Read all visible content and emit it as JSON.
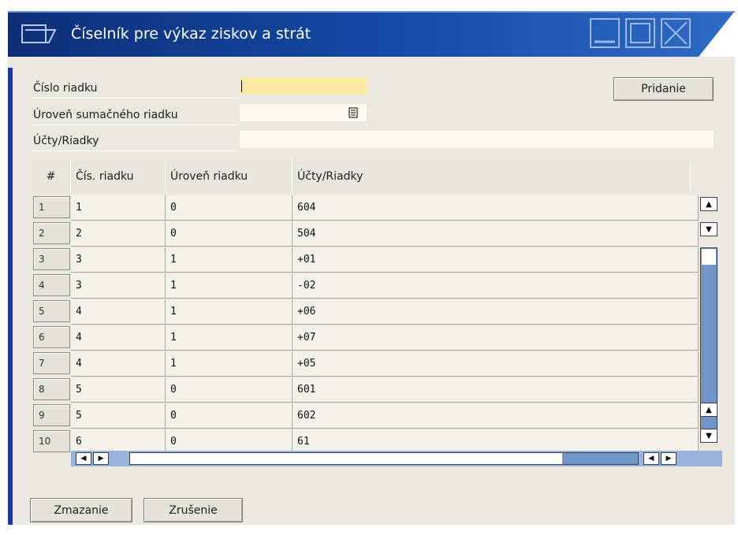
{
  "window": {
    "title": "Číselník pre výkaz ziskov a strát"
  },
  "form": {
    "row_number_label": "Číslo riadku",
    "row_number_value": "",
    "sum_level_label": "Úroveň sumačného riadku",
    "sum_level_value": "",
    "accounts_label": "Účty/Riadky",
    "accounts_value": "",
    "add_button": "Pridanie"
  },
  "table": {
    "columns": [
      "#",
      "Čís. riadku",
      "Úroveň riadku",
      "Účty/Riadky"
    ],
    "rows": [
      {
        "n": "1",
        "row": "1",
        "level": "0",
        "accounts": "604"
      },
      {
        "n": "2",
        "row": "2",
        "level": "0",
        "accounts": "504"
      },
      {
        "n": "3",
        "row": "3",
        "level": "1",
        "accounts": "+01"
      },
      {
        "n": "4",
        "row": "3",
        "level": "1",
        "accounts": "-02"
      },
      {
        "n": "5",
        "row": "4",
        "level": "1",
        "accounts": "+06"
      },
      {
        "n": "6",
        "row": "4",
        "level": "1",
        "accounts": "+07"
      },
      {
        "n": "7",
        "row": "4",
        "level": "1",
        "accounts": "+05"
      },
      {
        "n": "8",
        "row": "5",
        "level": "0",
        "accounts": "601"
      },
      {
        "n": "9",
        "row": "5",
        "level": "0",
        "accounts": "602"
      },
      {
        "n": "10",
        "row": "6",
        "level": "0",
        "accounts": "61"
      }
    ]
  },
  "footer": {
    "delete_button": "Zmazanie",
    "cancel_button": "Zrušenie"
  },
  "icons": {
    "window_icon": "form-window-icon",
    "lookup_icon": "list-lookup-icon"
  },
  "colors": {
    "title_bar": "#0f3a86",
    "accent_stripe": "#1a37a6",
    "active_field": "#fce9a3",
    "field_bg": "#fcfaf0",
    "window_bg": "#eae8e1"
  }
}
